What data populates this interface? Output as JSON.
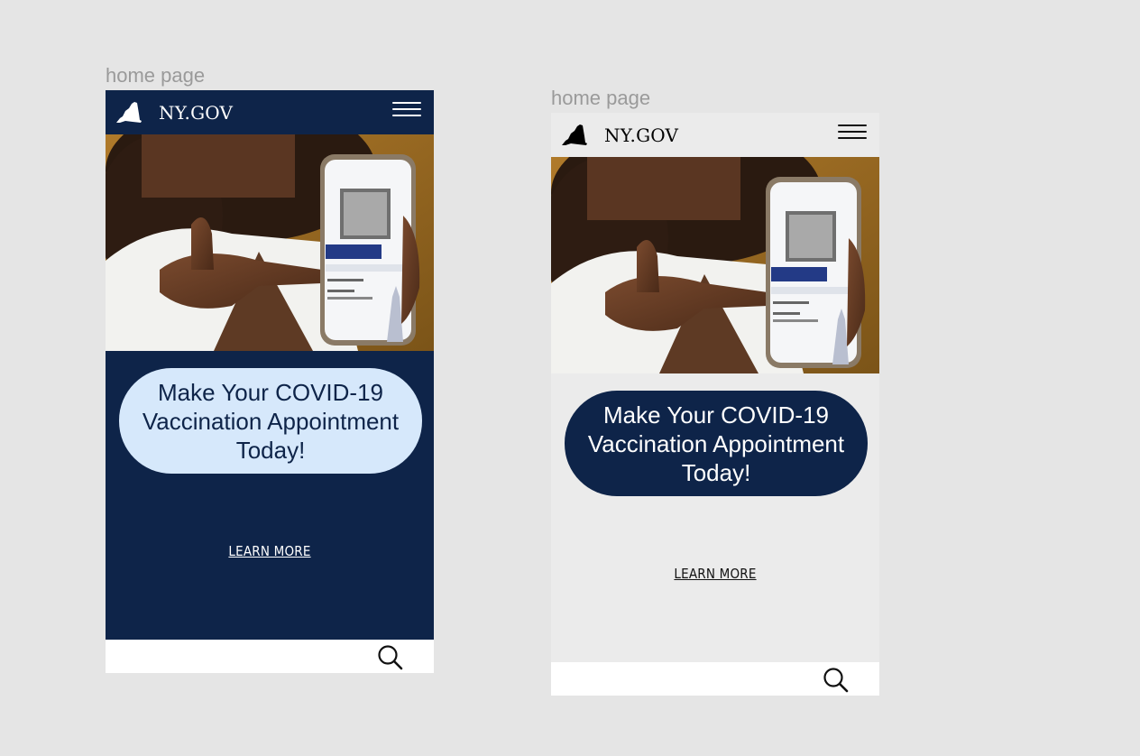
{
  "frames": [
    {
      "label": "home page",
      "brand": "NY.GOV",
      "cta": "Make Your COVID-19 Vaccination Appointment Today!",
      "learn_more": "LEARN MORE",
      "theme": "dark"
    },
    {
      "label": "home page",
      "brand": "NY.GOV",
      "cta": "Make Your COVID-19 Vaccination Appointment Today!",
      "learn_more": "LEARN MORE",
      "theme": "light"
    }
  ],
  "colors": {
    "navy": "#0e2449",
    "light_blue": "#d6e8fb",
    "light_gray": "#ebebeb",
    "canvas": "#e5e5e5"
  },
  "icons": {
    "menu": "hamburger-menu-icon",
    "search": "search-icon",
    "logo": "ny-state-shape-icon"
  }
}
